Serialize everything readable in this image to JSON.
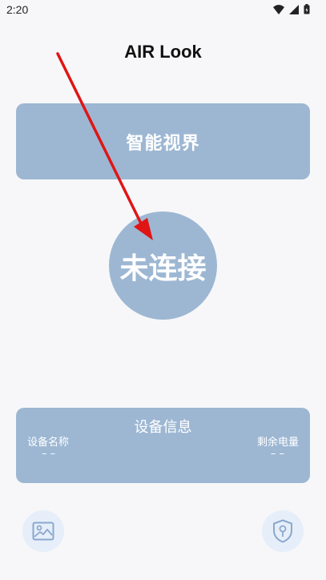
{
  "status_bar": {
    "time": "2:20"
  },
  "app": {
    "title": "AIR Look"
  },
  "vision_card": {
    "label": "智能视界"
  },
  "connection": {
    "status": "未连接"
  },
  "device_info": {
    "title": "设备信息",
    "name_label": "设备名称",
    "name_value": "– –",
    "battery_label": "剩余电量",
    "battery_value": "– –"
  },
  "bottom_nav": {
    "left_icon": "gallery-icon",
    "right_icon": "shield-key-icon"
  },
  "colors": {
    "card": "#9db7d3",
    "button_bg": "#e6eef9",
    "icon": "#8aa8cf",
    "arrow": "#e01515"
  }
}
